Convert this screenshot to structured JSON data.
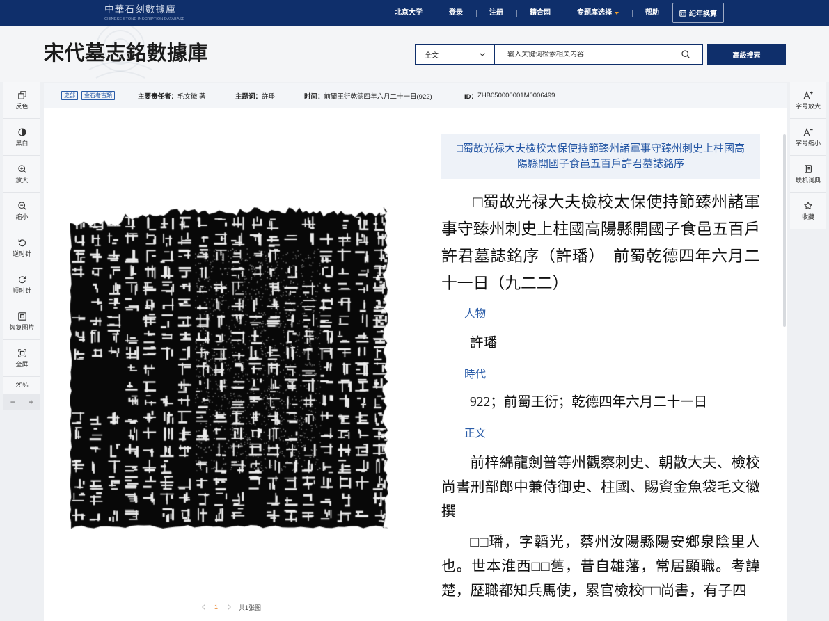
{
  "colors": {
    "nav_bg": "#0f2f6b",
    "accent": "#2a5ca8",
    "active_page": "#e8832a",
    "caret": "#f0a030",
    "title_box_bg": "#eef2f8"
  },
  "nav": {
    "logo_title": "中華石刻數據庫",
    "logo_subtitle": "CHINESE STONE INSCRIPTION DATABASE",
    "items": [
      "北京大学",
      "登录",
      "注册",
      "籍合网",
      "专题库选择",
      "帮助"
    ],
    "convert_button": "纪年换算",
    "convert_icon": "calendar-icon"
  },
  "header": {
    "title": "宋代墓志銘數據庫",
    "search_scope": "全文",
    "search_placeholder": "输入关键词检索相关内容",
    "advanced_search": "高級搜索"
  },
  "left_tools": [
    {
      "label": "反色",
      "icon": "invert-icon"
    },
    {
      "label": "黑白",
      "icon": "grayscale-icon"
    },
    {
      "label": "放大",
      "icon": "zoom-in-icon"
    },
    {
      "label": "缩小",
      "icon": "zoom-out-icon"
    },
    {
      "label": "逆时针",
      "icon": "rotate-ccw-icon"
    },
    {
      "label": "顺时针",
      "icon": "rotate-cw-icon"
    },
    {
      "label": "恢复图片",
      "icon": "restore-image-icon"
    },
    {
      "label": "全屏",
      "icon": "fullscreen-icon"
    }
  ],
  "zoom": {
    "level": "25%",
    "minus": "−",
    "plus": "+"
  },
  "right_tools": [
    {
      "label": "字号放大",
      "icon": "font-increase-icon"
    },
    {
      "label": "字号缩小",
      "icon": "font-decrease-icon"
    },
    {
      "label": "联机词典",
      "icon": "dictionary-icon"
    },
    {
      "label": "收藏",
      "icon": "star-icon"
    }
  ],
  "meta": {
    "tags": [
      "史部",
      "金石考古類"
    ],
    "author_label": "主要责任者：",
    "author": "毛文徽 著",
    "subject_label": "主题词：",
    "subject": "許璠",
    "time_label": "时间：",
    "time": "前蜀王衍乾德四年六月二十一日(922)",
    "id_label": "ID：",
    "id": "ZHB050000001M0006499"
  },
  "pagination": {
    "current": "1",
    "total": "共1张图"
  },
  "record": {
    "title_box": "□蜀故光禄大夫檢校太保使持節臻州諸軍事守臻州刺史上柱國高陽縣開國子食邑五百戶許君墓誌銘序",
    "heading": "□蜀故光禄大夫檢校太保使持節臻州諸軍事守臻州刺史上柱國高陽縣開國子食邑五百戶許君墓誌銘序（許璠）　前蜀乾德四年六月二十一日（九二二）",
    "person_label": "人物",
    "person": "許璠",
    "era_label": "時代",
    "era": "922；前蜀王衍；乾德四年六月二十一日",
    "body_label": "正文",
    "paragraphs": [
      "前梓綿龍劍普等州觀察刺史、朝散大夫、檢校尚書刑部郎中兼侍御史、柱國、賜資金魚袋毛文徽撰",
      "□□璠，字韜光，蔡州汝陽縣陽安鄉泉陰里人也。世本淮西□□舊，昔自雄藩，常居顯職。考諱楚，歷職都知兵馬使，累官檢校□□尚書，有子四"
    ]
  }
}
